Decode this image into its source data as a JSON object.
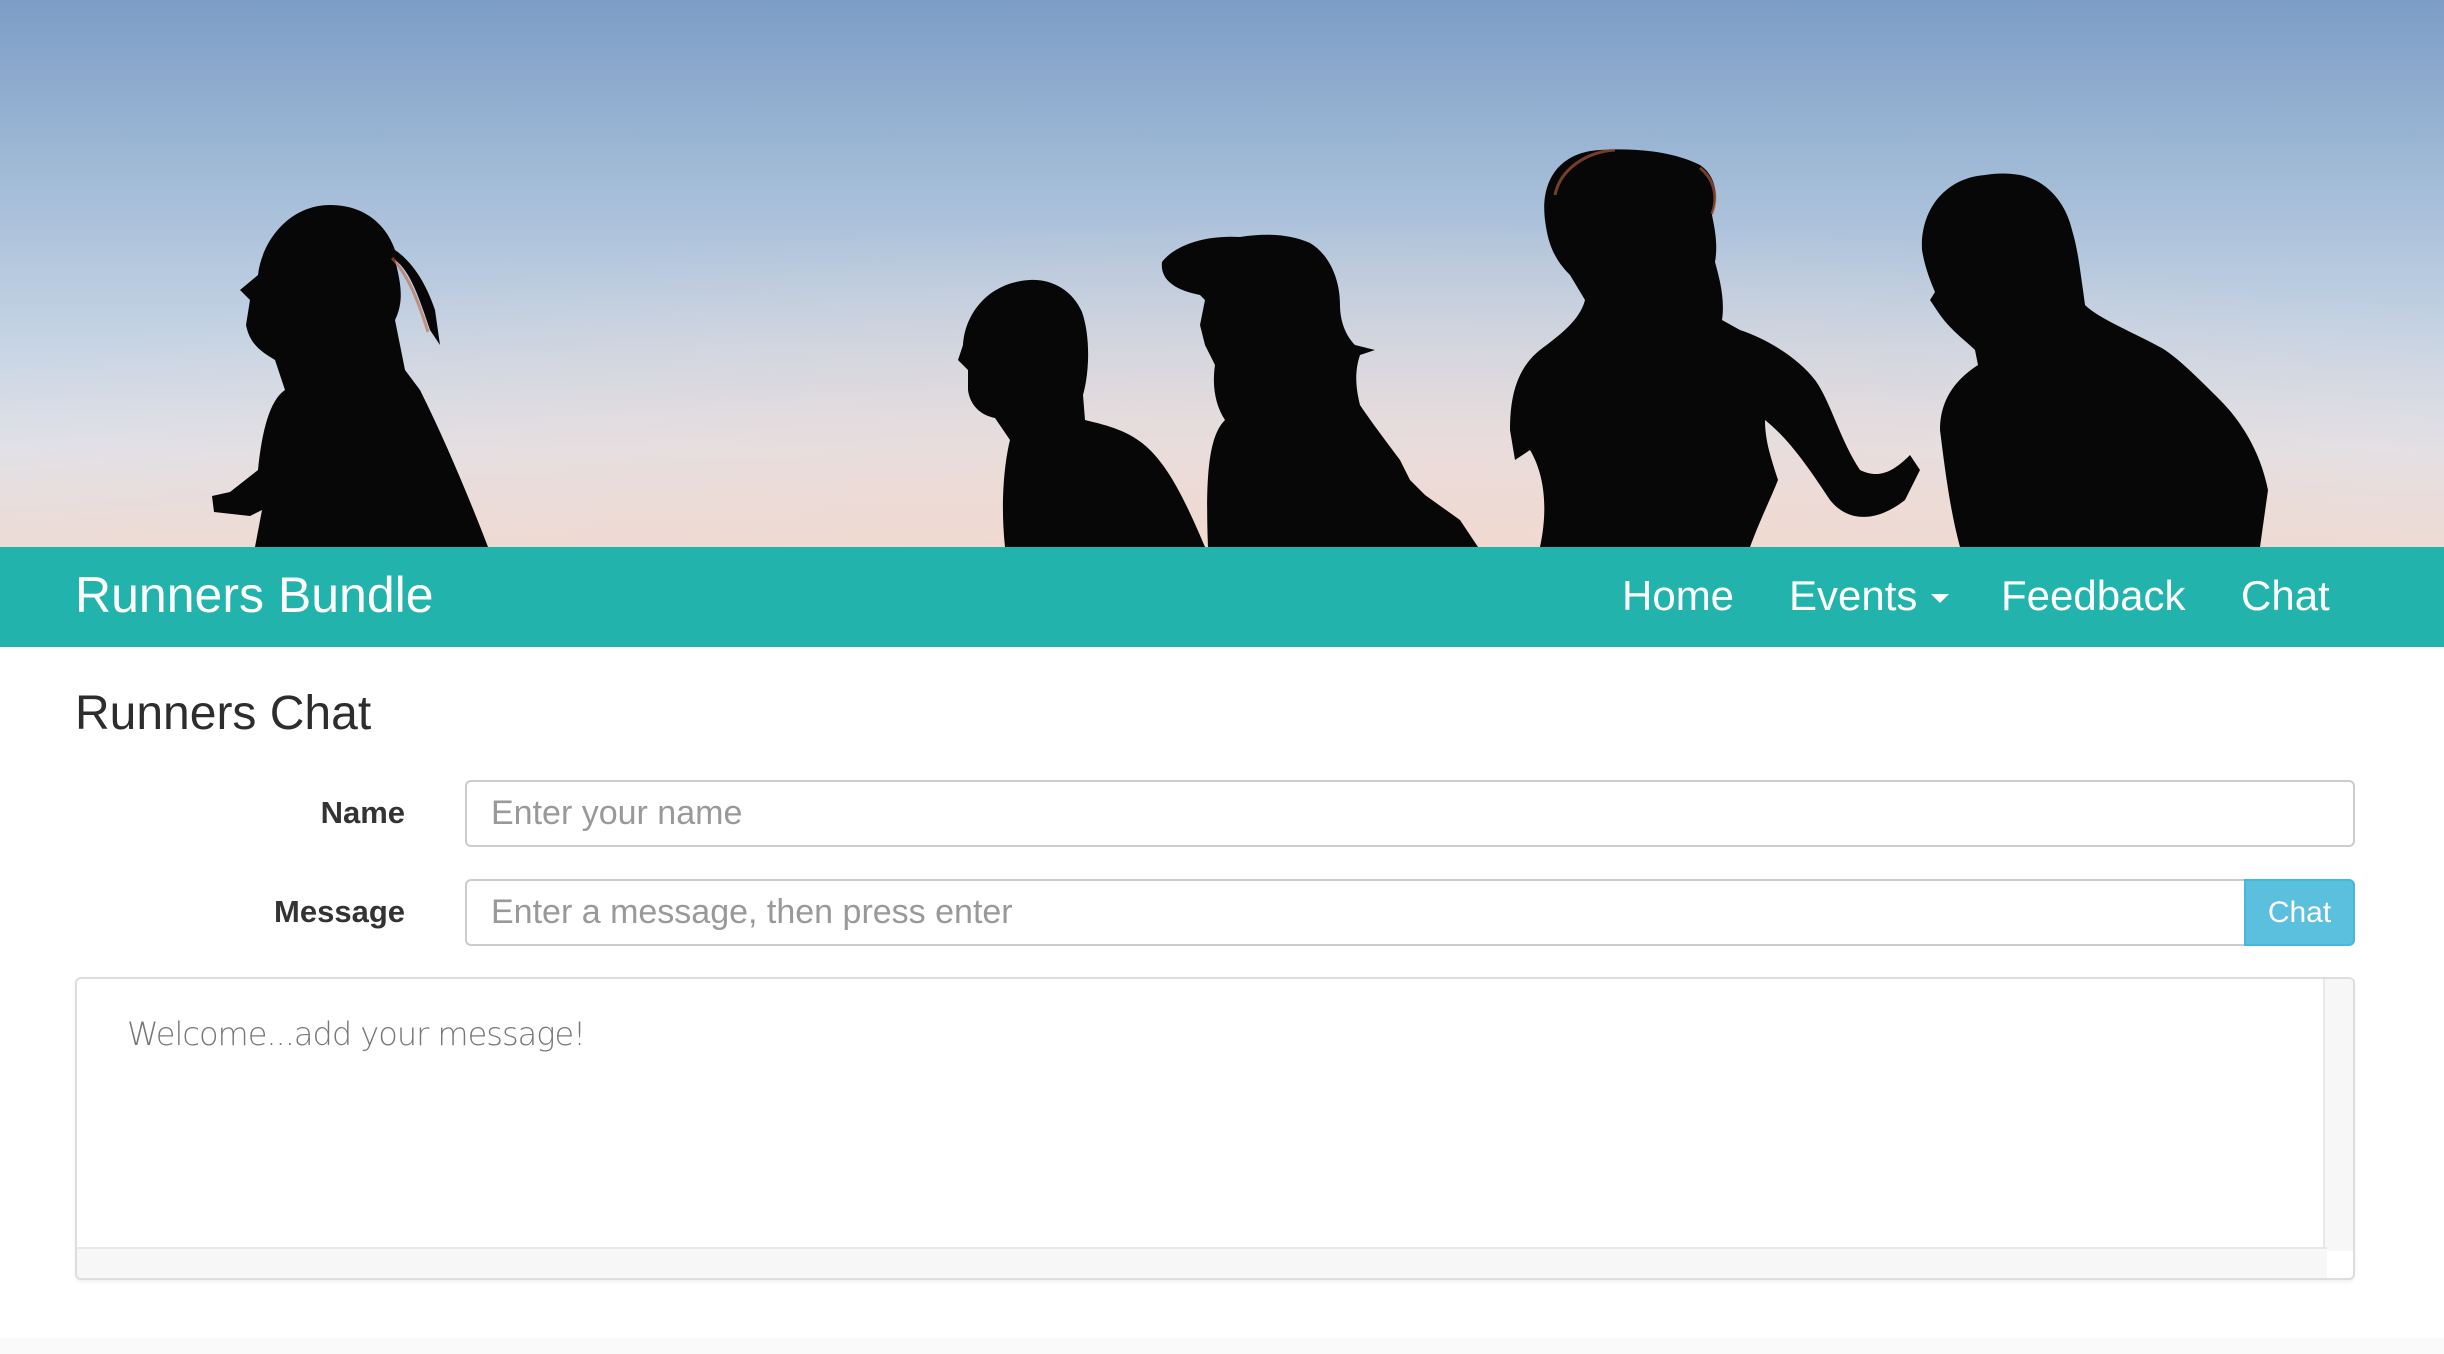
{
  "hero": {
    "image_alt": "runners-silhouette-banner"
  },
  "navbar": {
    "brand": "Runners Bundle",
    "items": [
      {
        "label": "Home"
      },
      {
        "label": "Events",
        "has_dropdown": true
      },
      {
        "label": "Feedback"
      },
      {
        "label": "Chat"
      }
    ],
    "bg_color": "#22b3ad"
  },
  "main": {
    "title": "Runners Chat",
    "form": {
      "name_label": "Name",
      "name_placeholder": "Enter your name",
      "name_value": "",
      "message_label": "Message",
      "message_placeholder": "Enter a message, then press enter",
      "message_value": "",
      "submit_label": "Chat"
    },
    "chat_log": {
      "welcome_text": "Welcome...add your message!"
    }
  },
  "colors": {
    "accent": "#22b3ad",
    "button": "#5bc0de"
  }
}
